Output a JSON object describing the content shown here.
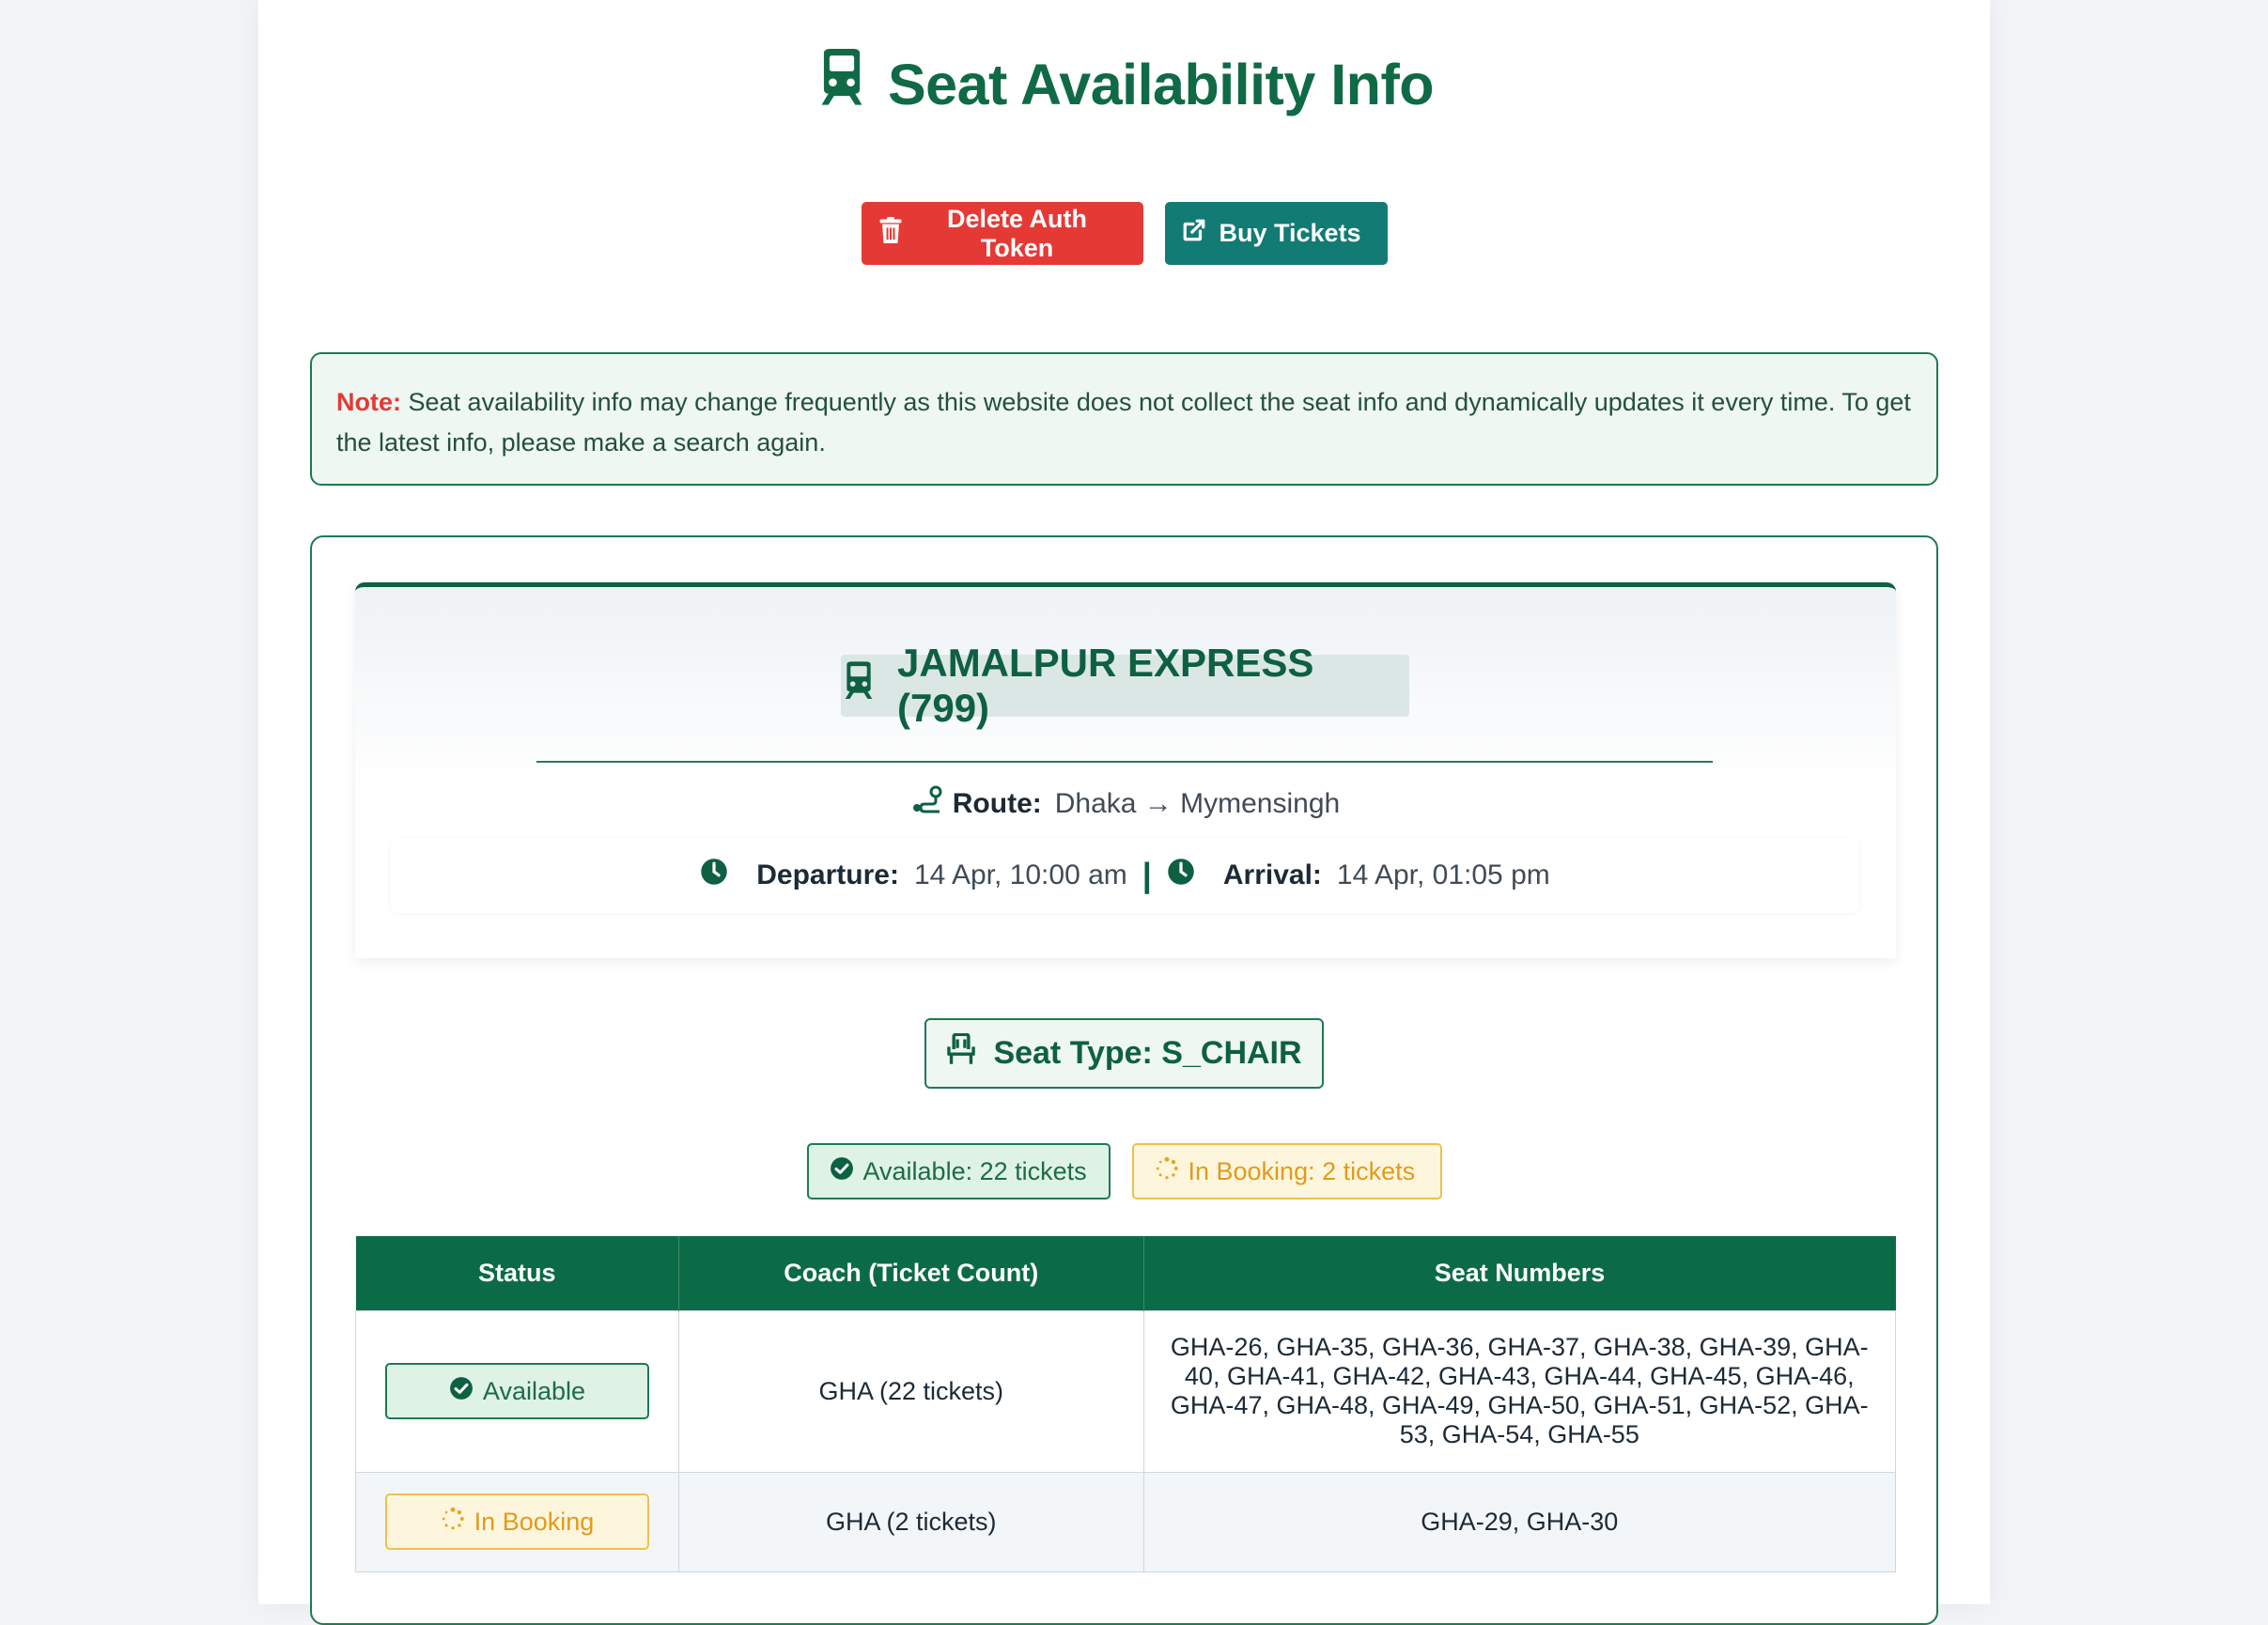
{
  "header": {
    "title": "Seat Availability Info",
    "title_icon": "train-icon"
  },
  "actions": {
    "delete_label": "Delete Auth Token",
    "buy_label": "Buy Tickets"
  },
  "note": {
    "label": "Note:",
    "text": "Seat availability info may change frequently as this website does not collect the seat info and dynamically updates it every time. To get the latest info, please make a search again."
  },
  "train": {
    "name": "JAMALPUR EXPRESS (799)",
    "route_label": "Route:",
    "route_value": "Dhaka → Mymensingh",
    "departure_label": "Departure:",
    "departure_value": "14 Apr, 10:00 am",
    "separator": "|",
    "arrival_label": "Arrival:",
    "arrival_value": "14 Apr, 01:05 pm"
  },
  "seat_type": {
    "label": "Seat Type: S_CHAIR"
  },
  "summary": {
    "available": "Available: 22 tickets",
    "in_booking": "In Booking: 2 tickets"
  },
  "table": {
    "headers": [
      "Status",
      "Coach (Ticket Count)",
      "Seat Numbers"
    ],
    "rows": [
      {
        "status": "Available",
        "coach": "GHA (22 tickets)",
        "seats": "GHA-26, GHA-35, GHA-36, GHA-37, GHA-38, GHA-39, GHA-40, GHA-41, GHA-42, GHA-43, GHA-44, GHA-45, GHA-46, GHA-47, GHA-48, GHA-49, GHA-50, GHA-51, GHA-52, GHA-53, GHA-54, GHA-55"
      },
      {
        "status": "In Booking",
        "coach": "GHA (2 tickets)",
        "seats": "GHA-29, GHA-30"
      }
    ]
  },
  "colors": {
    "brand_green": "#0e6042",
    "danger": "#e53935",
    "teal": "#127b74",
    "booking_amber": "#e39a1a"
  }
}
